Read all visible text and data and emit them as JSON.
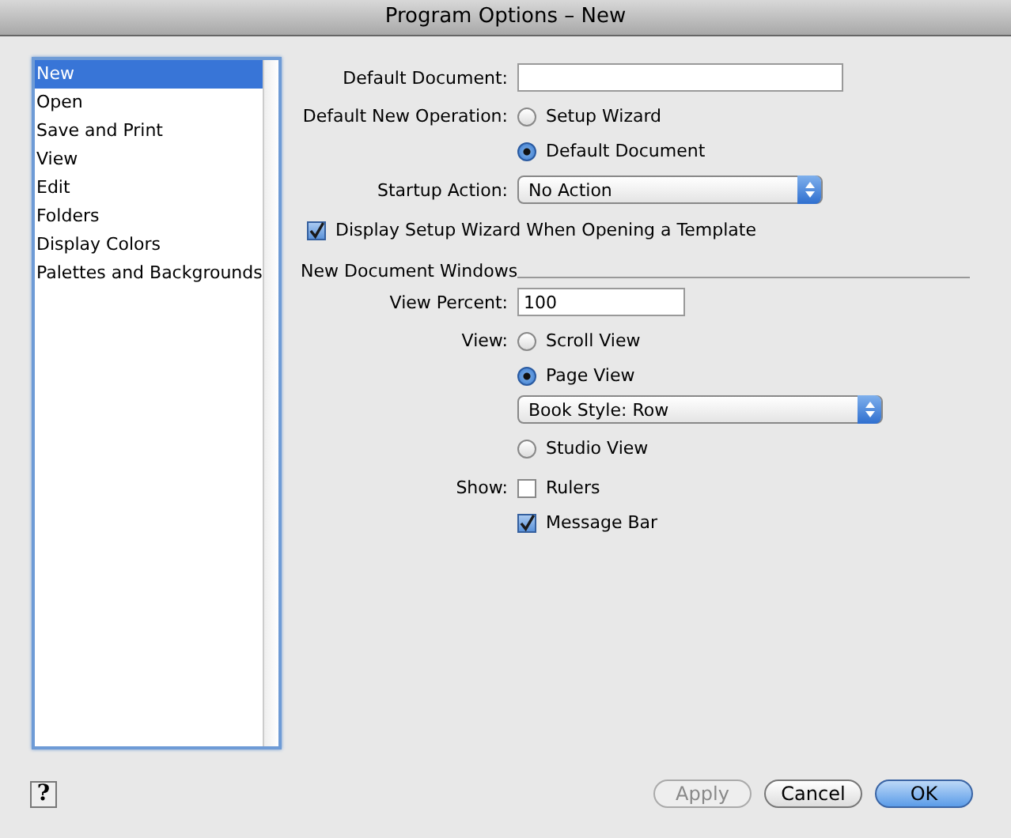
{
  "window": {
    "title": "Program Options – New"
  },
  "sidebar": {
    "items": [
      {
        "label": "New",
        "selected": true
      },
      {
        "label": "Open",
        "selected": false
      },
      {
        "label": "Save and Print",
        "selected": false
      },
      {
        "label": "View",
        "selected": false
      },
      {
        "label": "Edit",
        "selected": false
      },
      {
        "label": "Folders",
        "selected": false
      },
      {
        "label": "Display Colors",
        "selected": false
      },
      {
        "label": "Palettes and Backgrounds",
        "selected": false
      }
    ]
  },
  "default_document": {
    "label": "Default Document:"
  },
  "default_new_operation": {
    "label": "Default New Operation:",
    "options": [
      {
        "label": "Setup Wizard",
        "selected": false
      },
      {
        "label": "Default Document",
        "selected": true
      }
    ]
  },
  "startup_action": {
    "label": "Startup Action:",
    "value": "No Action"
  },
  "display_setup_wizard": {
    "label": "Display Setup Wizard When Opening a Template",
    "checked": true
  },
  "new_document_windows": {
    "heading": "New Document Windows",
    "view_percent": {
      "label": "View Percent:",
      "value": "100"
    },
    "view": {
      "label": "View:",
      "items": [
        {
          "kind": "radio",
          "label": "Scroll View",
          "selected": false
        },
        {
          "kind": "radio",
          "label": "Page View",
          "selected": true
        },
        {
          "kind": "popup",
          "value": "Book Style: Row"
        },
        {
          "kind": "radio",
          "label": "Studio View",
          "selected": false
        }
      ]
    },
    "show": {
      "label": "Show:",
      "options": [
        {
          "label": "Rulers",
          "checked": false
        },
        {
          "label": "Message Bar",
          "checked": true
        }
      ]
    }
  },
  "help_button": {
    "label": "?"
  },
  "buttons": [
    {
      "label": "Apply",
      "disabled": true,
      "default": false
    },
    {
      "label": "Cancel",
      "disabled": false,
      "default": false
    },
    {
      "label": "OK",
      "disabled": false,
      "default": true
    }
  ]
}
